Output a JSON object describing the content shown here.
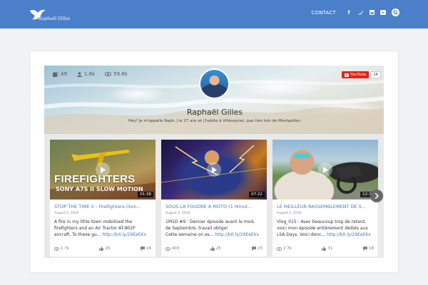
{
  "header": {
    "logo_text": "Raphaël Gilles",
    "nav_contact": "CONTACT",
    "social": [
      "f",
      "t",
      "in",
      "yt"
    ]
  },
  "profile": {
    "stats": {
      "videos": "49",
      "subscribers": "1.6k",
      "views": "59.6k"
    },
    "youtube_label": "YouTube",
    "youtube_count": "1K",
    "name": "Raphaël Gilles",
    "bio": "Hey! Je m'appelle Raph, j'ai 27 ans et j'habite à Villeveyrac, pas très loin de Montpellier."
  },
  "videos": [
    {
      "thumb_title": "FIREFIGHTERS",
      "thumb_subtitle": "SONY A7S II SLOW MOTION",
      "duration": "01:38",
      "title": "STOP THE TIME II - Firefighters (Son...",
      "date": "August 5, 2016",
      "desc_line1": "A fire in my little town mobilized the",
      "desc_line2": "firefighters and an Air Tractor AT-802F",
      "desc_line3": "aircraft. To these gu...",
      "link": "http://bit.ly/29EeEKx",
      "views": "1.7k",
      "likes": "25",
      "comments": "16"
    },
    {
      "duration": "07:22",
      "title": "SOUS LA FOUDRE A MOTO (1 Minut...",
      "date": "August 4, 2016",
      "desc_line1": "1M1D #9 : Dernier épisode avant le mois",
      "desc_line2": "de Septembre, travail oblige!",
      "desc_line3": "Cette semaine on es...",
      "link": "http://bit.ly/29EeEKx",
      "views": "403",
      "likes": "25",
      "comments": "23"
    },
    {
      "duration": "12:30",
      "title": "LE MEILLEUR RASSEMBLEMENT DE S...",
      "date": "August 1, 2016",
      "desc_line1": "Vlog_015 : Avec beaucoup trop de retard,",
      "desc_line2": "voici mon épisode entièrement dédiés aux",
      "desc_line3": "LSA Days. Voici donc...",
      "link": "http://bit.ly/29EeEKx",
      "views": "2.7k",
      "likes": "31",
      "comments": "18"
    }
  ],
  "colors": {
    "header_bg": "#4a7fc9",
    "link": "#3b7bc0",
    "youtube_red": "#e62117"
  }
}
